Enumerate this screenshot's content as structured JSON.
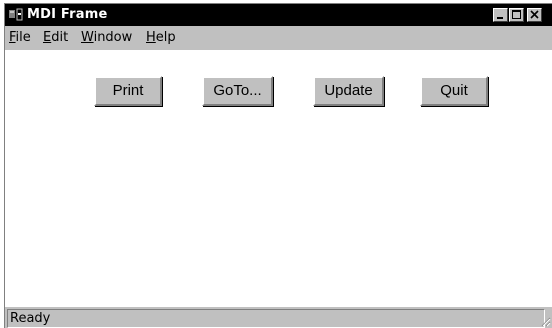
{
  "window": {
    "title": "MDI Frame",
    "app_icon": "app-icon",
    "controls": {
      "minimize_icon": "minimize-icon",
      "maximize_icon": "maximize-icon",
      "close_icon": "close-icon"
    }
  },
  "menu": {
    "items": [
      {
        "accel": "F",
        "rest": "ile"
      },
      {
        "accel": "E",
        "rest": "dit"
      },
      {
        "accel": "W",
        "rest": "indow"
      },
      {
        "accel": "H",
        "rest": "elp"
      }
    ]
  },
  "toolbar": {
    "print_label": "Print",
    "goto_label": "GoTo...",
    "update_label": "Update",
    "quit_label": "Quit"
  },
  "status": {
    "text": "Ready"
  },
  "colors": {
    "title_bg": "#000000",
    "face": "#c0c0c0",
    "client_bg": "#ffffff"
  }
}
